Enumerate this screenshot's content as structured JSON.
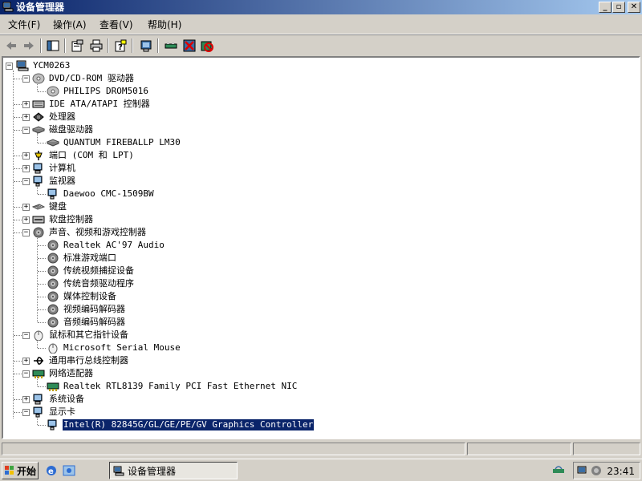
{
  "window": {
    "title": "设备管理器",
    "caption_buttons": [
      "_",
      "▫",
      "✕"
    ]
  },
  "menubar": {
    "items": [
      {
        "label": "文件(F)"
      },
      {
        "label": "操作(A)"
      },
      {
        "label": "查看(V)"
      },
      {
        "label": "帮助(H)"
      }
    ]
  },
  "toolbar": {
    "buttons": [
      "back-icon",
      "forward-icon",
      "show-hide-tree-icon",
      "properties-icon",
      "print-icon",
      "help-icon",
      "scan-hardware-icon",
      "update-driver-icon",
      "uninstall-icon",
      "disable-icon"
    ]
  },
  "tree": {
    "root": "YCM0263",
    "items": [
      {
        "label": "DVD/CD-ROM 驱动器",
        "level": 1,
        "expanded": true,
        "icon": "cdrom-icon"
      },
      {
        "label": "PHILIPS DROM5016",
        "level": 2,
        "icon": "cdrom-icon"
      },
      {
        "label": "IDE ATA/ATAPI 控制器",
        "level": 1,
        "expanded": false,
        "icon": "ide-controller-icon"
      },
      {
        "label": "处理器",
        "level": 1,
        "expanded": false,
        "icon": "processor-icon"
      },
      {
        "label": "磁盘驱动器",
        "level": 1,
        "expanded": true,
        "icon": "disk-drive-icon"
      },
      {
        "label": "QUANTUM FIREBALLP LM30",
        "level": 2,
        "icon": "disk-drive-icon"
      },
      {
        "label": "端口 (COM 和 LPT)",
        "level": 1,
        "expanded": false,
        "icon": "port-icon"
      },
      {
        "label": "计算机",
        "level": 1,
        "expanded": false,
        "icon": "computer-icon"
      },
      {
        "label": "监视器",
        "level": 1,
        "expanded": true,
        "icon": "monitor-icon"
      },
      {
        "label": "Daewoo CMC-1509BW",
        "level": 2,
        "icon": "monitor-icon"
      },
      {
        "label": "键盘",
        "level": 1,
        "expanded": false,
        "icon": "keyboard-icon"
      },
      {
        "label": "软盘控制器",
        "level": 1,
        "expanded": false,
        "icon": "floppy-controller-icon"
      },
      {
        "label": "声音、视频和游戏控制器",
        "level": 1,
        "expanded": true,
        "icon": "sound-icon"
      },
      {
        "label": "Realtek AC'97 Audio",
        "level": 2,
        "icon": "sound-icon"
      },
      {
        "label": "标准游戏端口",
        "level": 2,
        "icon": "sound-icon"
      },
      {
        "label": "传统视频捕捉设备",
        "level": 2,
        "icon": "sound-icon"
      },
      {
        "label": "传统音频驱动程序",
        "level": 2,
        "icon": "sound-icon"
      },
      {
        "label": "媒体控制设备",
        "level": 2,
        "icon": "sound-icon"
      },
      {
        "label": "视频编码解码器",
        "level": 2,
        "icon": "sound-icon"
      },
      {
        "label": "音频编码解码器",
        "level": 2,
        "icon": "sound-icon"
      },
      {
        "label": "鼠标和其它指针设备",
        "level": 1,
        "expanded": true,
        "icon": "mouse-icon"
      },
      {
        "label": "Microsoft Serial Mouse",
        "level": 2,
        "icon": "mouse-icon"
      },
      {
        "label": "通用串行总线控制器",
        "level": 1,
        "expanded": false,
        "icon": "usb-icon"
      },
      {
        "label": "网络适配器",
        "level": 1,
        "expanded": true,
        "icon": "network-adapter-icon"
      },
      {
        "label": "Realtek RTL8139 Family PCI Fast Ethernet NIC",
        "level": 2,
        "icon": "network-adapter-icon"
      },
      {
        "label": "系统设备",
        "level": 1,
        "expanded": false,
        "icon": "system-device-icon"
      },
      {
        "label": "显示卡",
        "level": 1,
        "expanded": true,
        "icon": "display-adapter-icon"
      },
      {
        "label": "Intel(R) 82845G/GL/GE/PE/GV Graphics Controller",
        "level": 2,
        "icon": "display-adapter-icon",
        "selected": true
      }
    ]
  },
  "taskbar": {
    "start_label": "开始",
    "task_label": "设备管理器",
    "clock": "23:41"
  },
  "colors": {
    "title_start": "#0a246a",
    "title_end": "#a6caf0",
    "selection": "#0a246a",
    "face": "#d4d0c8"
  }
}
